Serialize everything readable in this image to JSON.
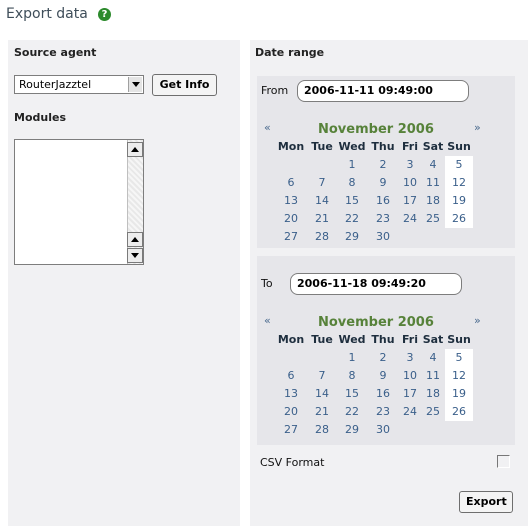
{
  "page": {
    "title": "Export data"
  },
  "left": {
    "source_agent_label": "Source agent",
    "agent_select_value": "RouterJazztel",
    "get_info_label": "Get Info",
    "modules_label": "Modules"
  },
  "right": {
    "date_range_label": "Date range",
    "from_label": "From",
    "from_value": "2006-11-11 09:49:00",
    "to_label": "To",
    "to_value": "2006-11-18 09:49:20",
    "csv_label": "CSV Format",
    "export_label": "Export"
  },
  "calendar": {
    "prev": "«",
    "next": "»",
    "month": "November 2006",
    "weekdays": [
      "Mon",
      "Tue",
      "Wed",
      "Thu",
      "Fri",
      "Sat",
      "Sun"
    ],
    "weeks": [
      [
        "",
        "",
        "1",
        "2",
        "3",
        "4",
        "5"
      ],
      [
        "6",
        "7",
        "8",
        "9",
        "10",
        "11",
        "12"
      ],
      [
        "13",
        "14",
        "15",
        "16",
        "17",
        "18",
        "19"
      ],
      [
        "20",
        "21",
        "22",
        "23",
        "24",
        "25",
        "26"
      ],
      [
        "27",
        "28",
        "29",
        "30",
        "",
        "",
        ""
      ]
    ]
  },
  "colors": {
    "panel_bg": "#f1f1f3",
    "calendar_bg": "#e6e6ea",
    "month_green": "#57823a",
    "day_blue": "#3a5f8a"
  }
}
